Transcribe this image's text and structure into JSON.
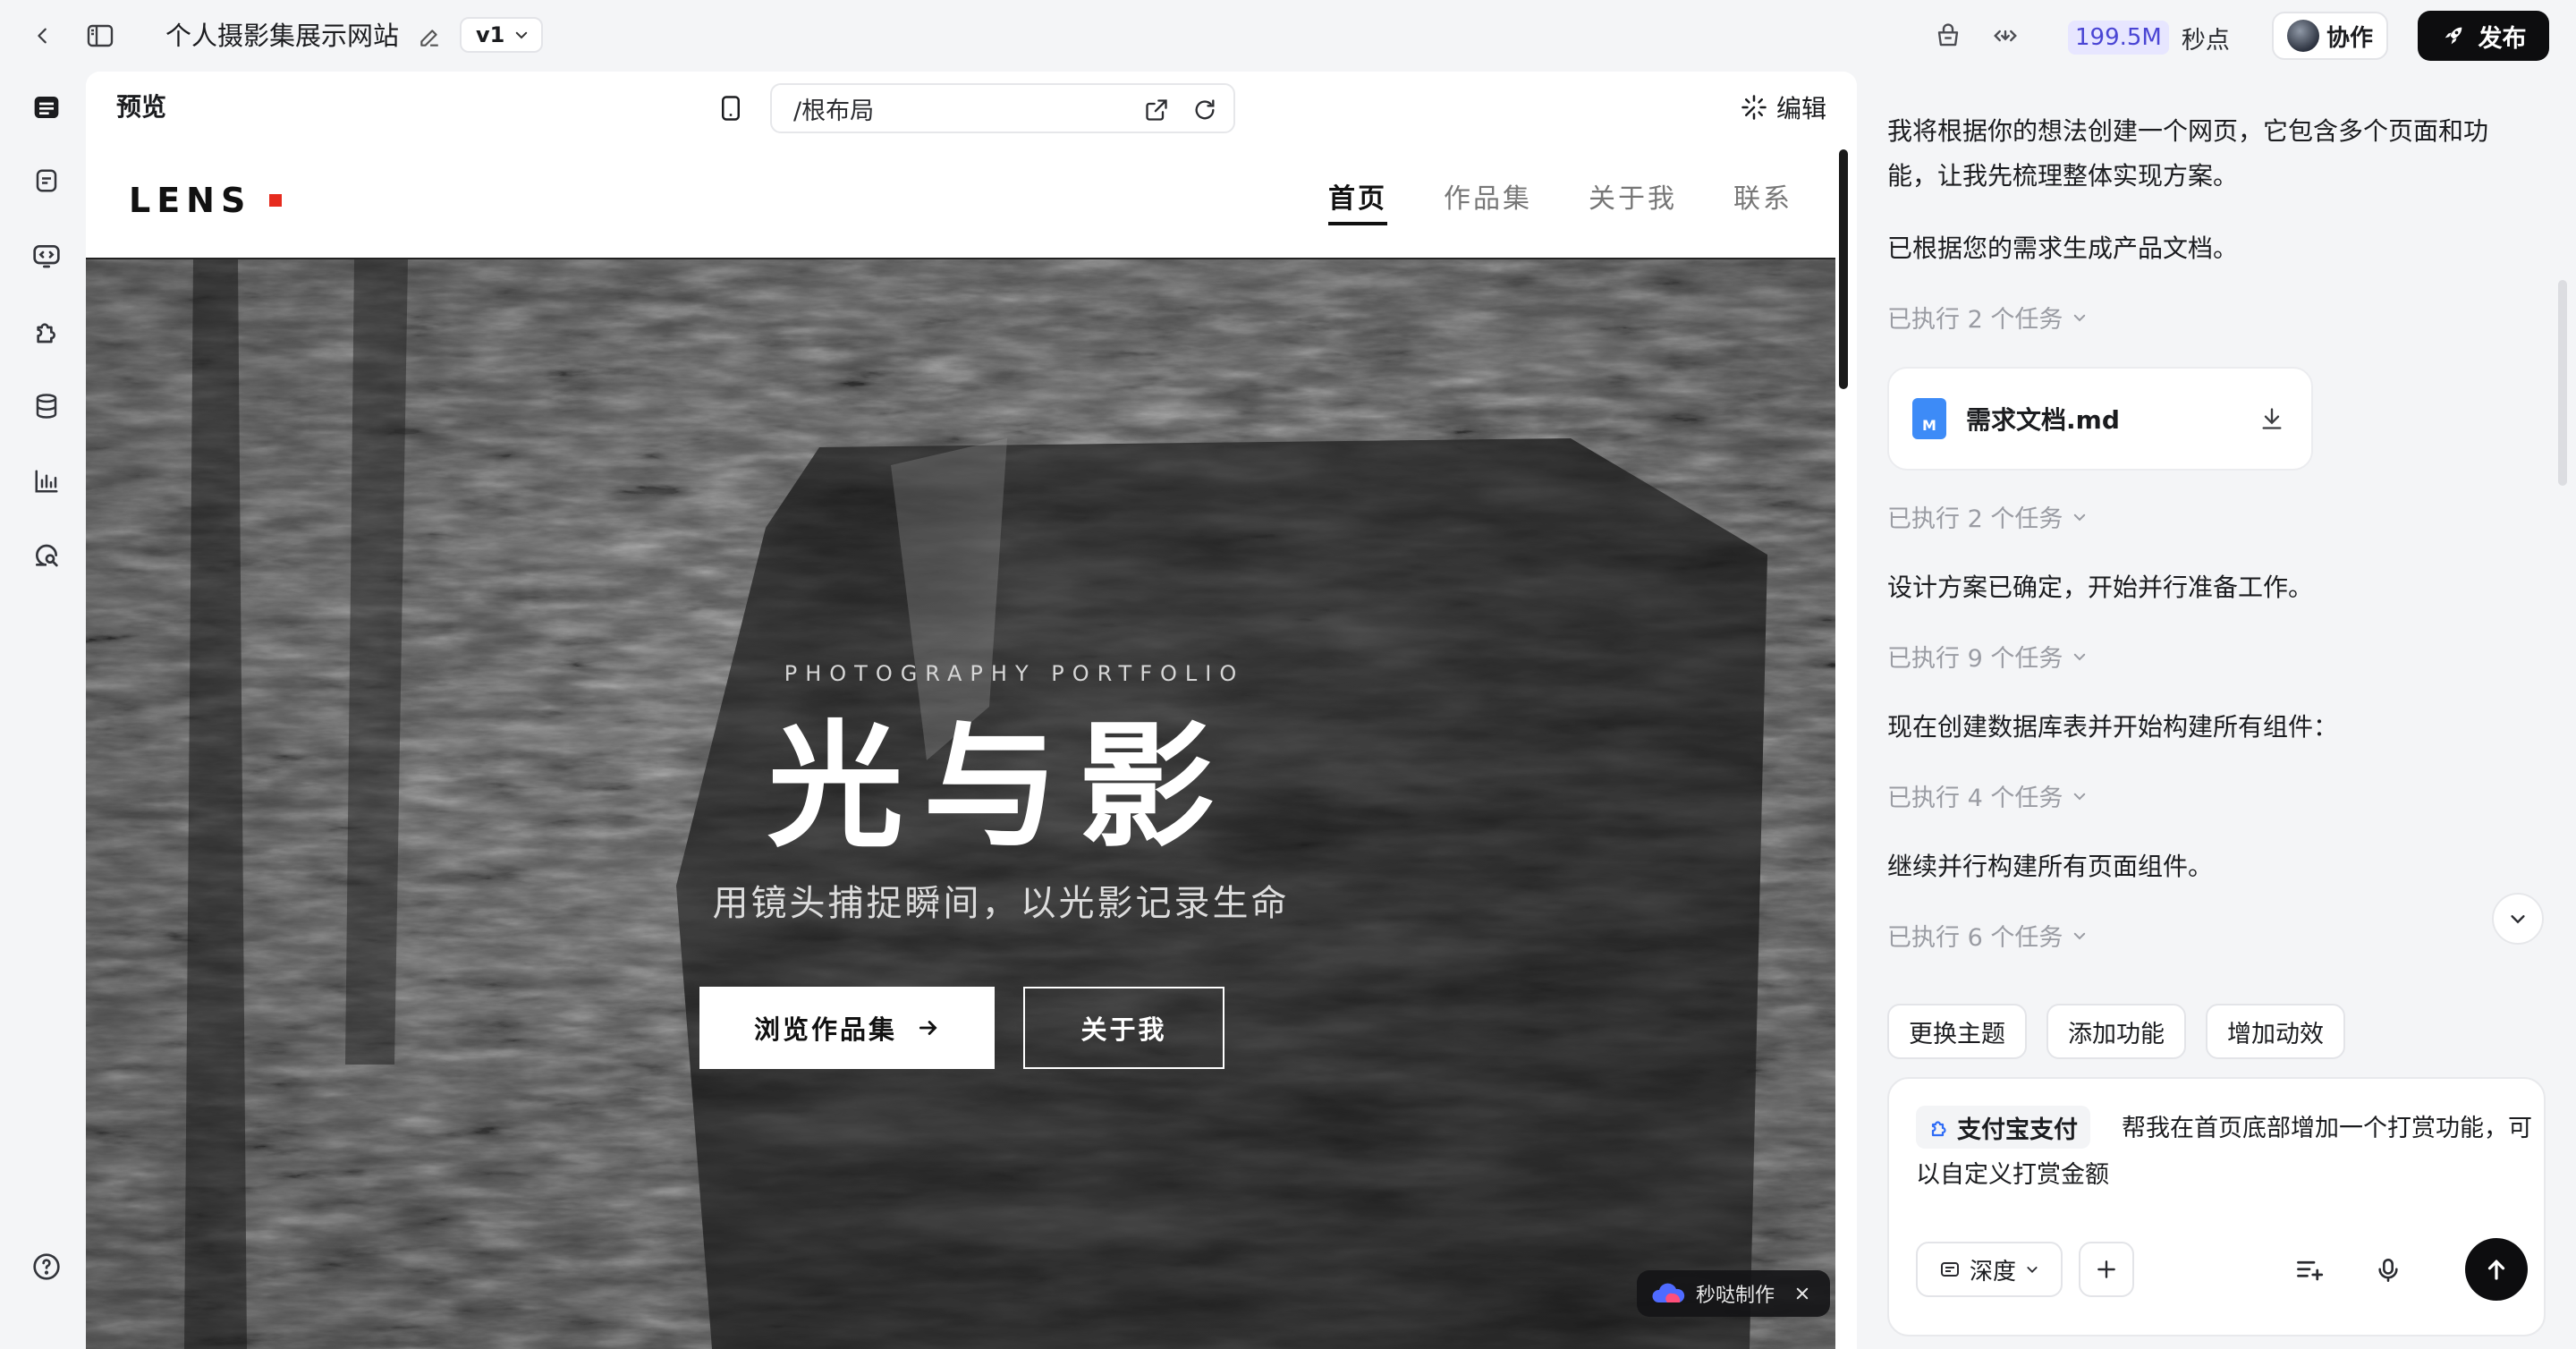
{
  "topbar": {
    "project_title": "个人摄影集展示网站",
    "version": "v1",
    "points_value": "199.5M",
    "points_label": "秒点",
    "collab_label": "协作",
    "publish_label": "发布"
  },
  "preview": {
    "title": "预览",
    "url": "/根布局",
    "edit_label": "编辑"
  },
  "site": {
    "logo": "LENS",
    "nav": [
      {
        "label": "首页",
        "active": true
      },
      {
        "label": "作品集",
        "active": false
      },
      {
        "label": "关于我",
        "active": false
      },
      {
        "label": "联系",
        "active": false
      }
    ],
    "hero": {
      "kicker": "PHOTOGRAPHY PORTFOLIO",
      "title": "光与影",
      "subtitle": "用镜头捕捉瞬间，以光影记录生命",
      "primary_button": "浏览作品集",
      "secondary_button": "关于我"
    },
    "badge": "秒哒制作"
  },
  "chat": {
    "messages": [
      "我将根据你的想法创建一个网页，它包含多个页面和功能，让我先梳理整体实现方案。",
      "已根据您的需求生成产品文档。",
      "设计方案已确定，开始并行准备工作。",
      "现在创建数据库表并开始构建所有组件：",
      "继续并行构建所有页面组件。"
    ],
    "tasks": [
      "已执行 2 个任务",
      "已执行 2 个任务",
      "已执行 9 个任务",
      "已执行 4 个任务",
      "已执行 6 个任务"
    ],
    "file": {
      "name": "需求文档.md",
      "icon_letter": "M"
    },
    "suggestions": [
      "更换主题",
      "添加功能",
      "增加动效"
    ],
    "composer": {
      "tag": "支付宝支付",
      "text": "帮我在首页底部增加一个打赏功能，可以自定义打赏金额",
      "mode_label": "深度"
    }
  },
  "colors": {
    "accent_red": "#e62b1e",
    "points_bg": "#e7e6ff",
    "points_text": "#4a45d4",
    "publish_bg": "#0d0d0f"
  }
}
